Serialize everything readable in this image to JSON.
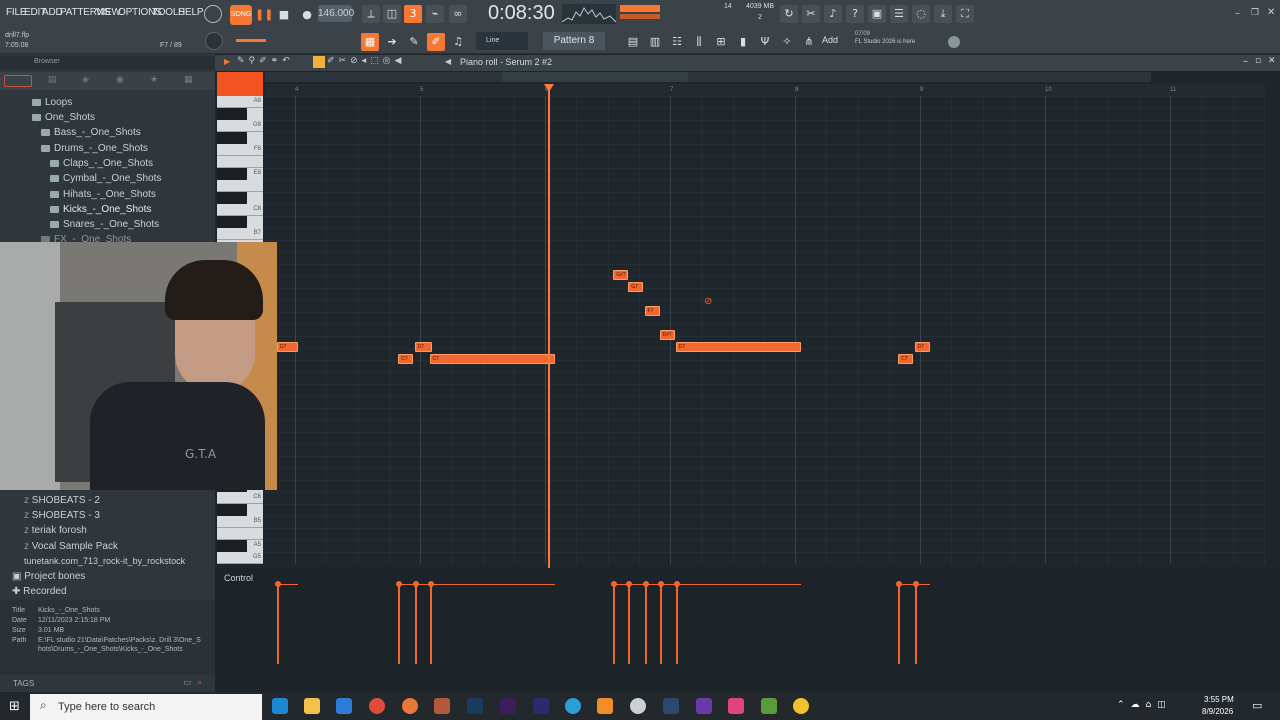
{
  "menu": [
    "FILE",
    "EDIT",
    "ADD",
    "PATTERNS",
    "VIEW",
    "OPTIONS",
    "TOOLS",
    "HELP"
  ],
  "transport": {
    "song_label": "SONG",
    "tempo": "146.000",
    "time": "0:08:30",
    "pattern": "Pattern 8",
    "snap": "Line",
    "add": "Add"
  },
  "project": {
    "name": "drill7.flp",
    "time": "7:05:08",
    "position": "F7 / 89"
  },
  "monitor": {
    "voices": "14",
    "ram": "4039 MB",
    "cpu": "2"
  },
  "news": {
    "date": "07/09",
    "text": "FL Studio 2026 is here"
  },
  "browser": {
    "title": "Browser",
    "tree": [
      {
        "label": "Loops",
        "indent": 0
      },
      {
        "label": "One_Shots",
        "indent": 0
      },
      {
        "label": "Bass_-_One_Shots",
        "indent": 1
      },
      {
        "label": "Drums_-_One_Shots",
        "indent": 1
      },
      {
        "label": "Claps_-_One_Shots",
        "indent": 2
      },
      {
        "label": "Cymbal_-_One_Shots",
        "indent": 2
      },
      {
        "label": "Hihats_-_One_Shots",
        "indent": 2
      },
      {
        "label": "Kicks_-_One_Shots",
        "indent": 2
      },
      {
        "label": "Snares_-_One_Shots",
        "indent": 2
      },
      {
        "label": "FX_-_One_Shots",
        "indent": 1
      }
    ],
    "packs": [
      "SHOBEATS - 2",
      "SHOBEATS - 3",
      "teriak forosh",
      "Vocal Sample Pack",
      "tunetank.com_713_rock-it_by_rockstock"
    ],
    "sections": [
      "Project bones",
      "Recorded"
    ],
    "info": {
      "title_label": "Title",
      "title": "Kicks_-_One_Shots",
      "date_label": "Date",
      "date": "12/11/2023 2:15:18 PM",
      "size_label": "Size",
      "size": "3.01 MB",
      "path_label": "Path",
      "path1": "E:\\FL studio 21\\Data\\Patches\\Packs\\z. Drill 3\\One_S",
      "path2": "hots\\Drums_-_One_Shots\\Kicks_-_One_Shots"
    },
    "tags_label": "TAGS"
  },
  "pianoroll": {
    "title": "Piano roll - Serum 2 #2",
    "control_label": "Control",
    "ruler": [
      "4",
      "5",
      "6",
      "7",
      "8",
      "9",
      "10",
      "11"
    ],
    "keys": [
      "A8",
      "G8",
      "F8",
      "E8",
      "C8",
      "B7",
      "C6",
      "B5",
      "A5",
      "G5"
    ],
    "notes": [
      {
        "label": "D7",
        "start": 0.0,
        "len": 0.17,
        "row": 7
      },
      {
        "label": "D7",
        "start": 1.1,
        "len": 0.14,
        "row": 7
      },
      {
        "label": "C7",
        "start": 0.97,
        "len": 0.12,
        "row": 8
      },
      {
        "label": "C7",
        "start": 1.22,
        "len": 1.0,
        "row": 8
      },
      {
        "label": "G#7",
        "start": 2.69,
        "len": 0.12,
        "row": 1
      },
      {
        "label": "G7",
        "start": 2.81,
        "len": 0.12,
        "row": 2
      },
      {
        "label": "F7",
        "start": 2.94,
        "len": 0.12,
        "row": 4
      },
      {
        "label": "D#7",
        "start": 3.06,
        "len": 0.12,
        "row": 6
      },
      {
        "label": "D7",
        "start": 3.19,
        "len": 1.0,
        "row": 7
      },
      {
        "label": "D7",
        "start": 5.1,
        "len": 0.12,
        "row": 7
      },
      {
        "label": "C7",
        "start": 4.97,
        "len": 0.12,
        "row": 8
      }
    ],
    "playhead_beat": 2.1,
    "velocity_level": 0.83
  },
  "taskbar": {
    "search": "Type here to search",
    "time": "3:55 PM",
    "date": "8/9/2026"
  },
  "colors": {
    "accent": "#f47833",
    "note": "#f2672e",
    "bg": "#1e262c"
  }
}
